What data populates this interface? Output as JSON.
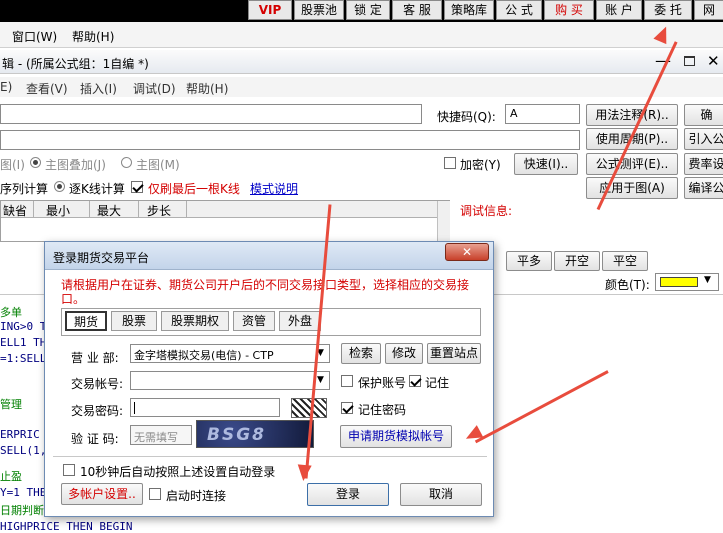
{
  "topbar": {
    "buttons": [
      "VIP",
      "股票池",
      "锁 定",
      "客 服",
      "策略库",
      "公 式",
      "购 买",
      "账 户",
      "委 托",
      "网"
    ],
    "colors": {
      "vip": "#d40000",
      "buy": "#d40000"
    }
  },
  "menubar": {
    "window": "窗口(W)",
    "help": "帮助(H)"
  },
  "editor": {
    "title": "辑 - (所属公式组：1自编 *)",
    "menu": [
      "E)",
      "查看(V)",
      "插入(I)",
      "调试(D)",
      "帮助(H)"
    ],
    "shortcut_label": "快捷码(Q):",
    "shortcut_value": "A",
    "right_buttons": [
      "用法注释(R)..",
      "使用周期(P)..",
      "公式测评(E)..",
      "应用于图(A)"
    ],
    "far_right_buttons": [
      "确",
      "引入公",
      "费率设",
      "编译公"
    ],
    "overlay_options": [
      "图(I)",
      "主图叠加(J)",
      "主图(M)"
    ],
    "encrypt_label": "加密(Y)",
    "quick_button": "快速(I)..",
    "calc_options": [
      "序列计算",
      "逐K线计算"
    ],
    "last_kline_label": "仅刷最后一根K线",
    "model_link": "模式说明",
    "table_headers": [
      "缺省",
      "最小",
      "最大",
      "步长"
    ],
    "debug_label": "调试信息:",
    "mid_buttons": [
      "平多",
      "开空",
      "平空"
    ],
    "color_label": "颜色(T):",
    "color_value": "#ffff00",
    "code_lines": [
      {
        "text": "多单",
        "color": "#008000"
      },
      {
        "text": "ING>0 T",
        "color": "#000080"
      },
      {
        "text": "ELL1 TH",
        "color": "#000080"
      },
      {
        "text": "=1:SELL",
        "color": "#000080"
      },
      {
        "text": "管理",
        "color": "#008000"
      },
      {
        "text": "ERPRIC",
        "color": "#000080"
      },
      {
        "text": "SELL(1,",
        "color": "#000080"
      },
      {
        "text": "止盈",
        "color": "#008000"
      },
      {
        "text": "Y=1 THE",
        "color": "#000080"
      },
      {
        "text": "日期判断",
        "color": "#008000"
      },
      {
        "text": "HIGHPRICE THEN BEGIN",
        "color": "#000080"
      }
    ]
  },
  "dialog": {
    "title": "登录期货交易平台",
    "notice": "请根据用户在证券、期货公司开户后的不同交易接口类型，选择相应的交易接口。",
    "tabs": [
      "期货",
      "股票",
      "股票期权",
      "资管",
      "外盘"
    ],
    "business_label": "营 业 部:",
    "business_value": "金字塔模拟交易(电信) - CTP",
    "search_btn": "检索",
    "modify_btn": "修改",
    "reset_btn": "重置站点",
    "account_label": "交易帐号:",
    "protect_label": "保护账号",
    "remember_label": "记住",
    "password_label": "交易密码:",
    "remember_pwd_label": "记住密码",
    "captcha_label": "验 证 码:",
    "captcha_placeholder": "无需填写",
    "captcha_text": "BSG8",
    "apply_btn": "申请期货模拟帐号",
    "autologin_label": "10秒钟后自动按照上述设置自动登录",
    "multi_account": "多帐户设置..",
    "startup_label": "启动时连接",
    "login_btn": "登录",
    "cancel_btn": "取消"
  }
}
